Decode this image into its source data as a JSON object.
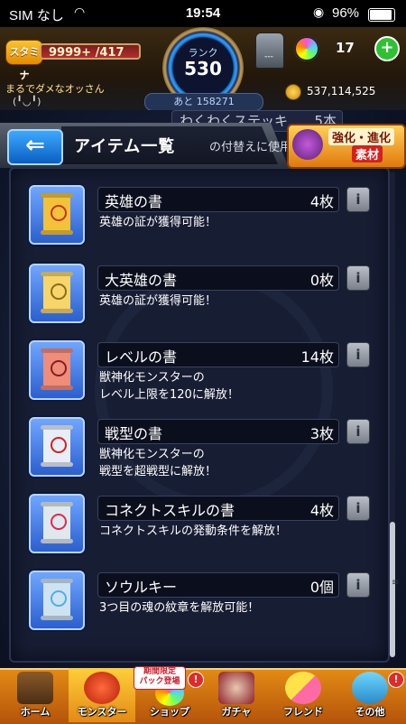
{
  "status_bar": {
    "carrier": "SIM なし",
    "time": "19:54",
    "battery": "96%"
  },
  "header": {
    "stamina_label": "スタミナ",
    "stamina_value": "9999+ /417",
    "rank_label": "ランク",
    "rank_value": "530",
    "next_rank": "あと 158271",
    "lamp_value": "---",
    "orb_count": "17",
    "plus_label": "+",
    "username": "まるでダメなオッさん",
    "face": "(╹◡╹)",
    "coins": "537,114,525"
  },
  "title_section": {
    "back_arrow": "⇐",
    "title": "アイテム一覧",
    "subtitle": "の付替えに使用！",
    "partial_item_name": "わくわくステッキ",
    "partial_item_count": "5本",
    "evolve_button_top": "強化・進化",
    "evolve_button_bottom": "素材"
  },
  "items": [
    {
      "name": "英雄の書",
      "count": "4枚",
      "desc": "英雄の証が獲得可能！",
      "color": "#f2c23a",
      "emblem": "#c8321e"
    },
    {
      "name": "大英雄の書",
      "count": "0枚",
      "desc": "英雄の証が獲得可能！",
      "color": "#f7d56a",
      "emblem": "#8a6d1a"
    },
    {
      "name": "レベルの書",
      "count": "14枚",
      "desc": "獣神化モンスターの\nレベル上限を120に解放！",
      "color": "#f08c7a",
      "emblem": "#8a1e1e"
    },
    {
      "name": "戦型の書",
      "count": "3枚",
      "desc": "獣神化モンスターの\n戦型を超戦型に解放！",
      "color": "#e8eef8",
      "emblem": "#d81e1e"
    },
    {
      "name": "コネクトスキルの書",
      "count": "4枚",
      "desc": "コネクトスキルの発動条件を解放！",
      "color": "#dfe8ee",
      "emblem": "#e0294a"
    },
    {
      "name": "ソウルキー",
      "count": "0個",
      "desc": "3つ目の魂の紋章を解放可能！",
      "color": "#cfe2f2",
      "emblem": "#4ab0e8"
    }
  ],
  "bottom_nav": {
    "home": "ホーム",
    "monster": "モンスター",
    "shop": "ショップ",
    "shop_badge": "期間限定\nパック登場",
    "gacha": "ガチャ",
    "friend": "フレンド",
    "other": "その他",
    "notif": "!"
  }
}
